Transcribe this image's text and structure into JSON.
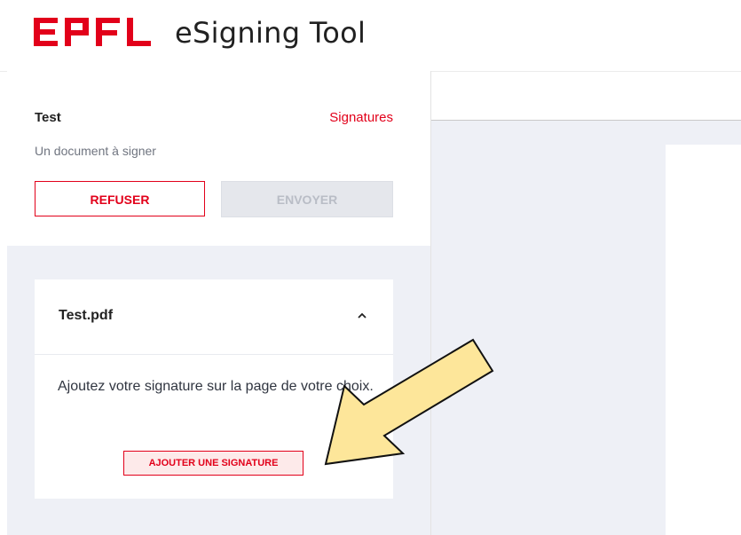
{
  "header": {
    "logo_text": "EPFL",
    "app_title": "eSigning Tool"
  },
  "sidebar": {
    "document_title": "Test",
    "signatures_link": "Signatures",
    "document_description": "Un document à signer",
    "refuse_button": "REFUSER",
    "send_button": "ENVOYER",
    "file_card": {
      "file_name": "Test.pdf",
      "instructions": "Ajoutez votre signature sur la page de votre choix.",
      "add_signature_button": "AJOUTER UNE SIGNATURE"
    }
  },
  "colors": {
    "brand": "#e2001a",
    "arrow_fill": "#fde69a",
    "sidebar_bg": "#eef0f6"
  },
  "icons": {
    "collapse": "chevron-up-icon",
    "annotation": "arrow-annotation"
  }
}
